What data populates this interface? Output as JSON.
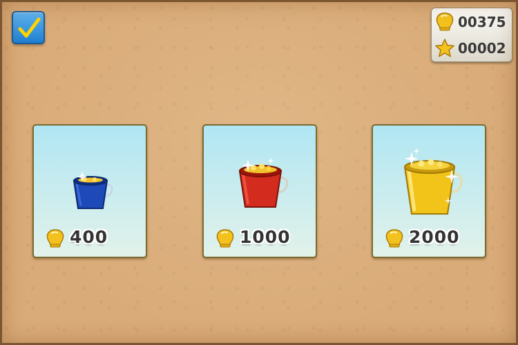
{
  "header": {
    "confirm_icon": "checkmark-icon"
  },
  "currency": {
    "coins": "00375",
    "coin_icon": "gold-coin-icon",
    "stars": "00002",
    "star_icon": "star-icon"
  },
  "shop": {
    "items": [
      {
        "icon": "blue-bucket-icon",
        "price": "400",
        "price_icon": "gold-coin-icon"
      },
      {
        "icon": "red-bucket-icon",
        "price": "1000",
        "price_icon": "gold-coin-icon"
      },
      {
        "icon": "gold-bucket-icon",
        "price": "2000",
        "price_icon": "gold-coin-icon"
      }
    ]
  },
  "colors": {
    "background_sand": "#d9ab78",
    "card_top": "#b0e6f3",
    "card_bottom": "#e2f2ea",
    "confirm_blue": "#1f7fd0",
    "coin_gold": "#f4c21e"
  }
}
